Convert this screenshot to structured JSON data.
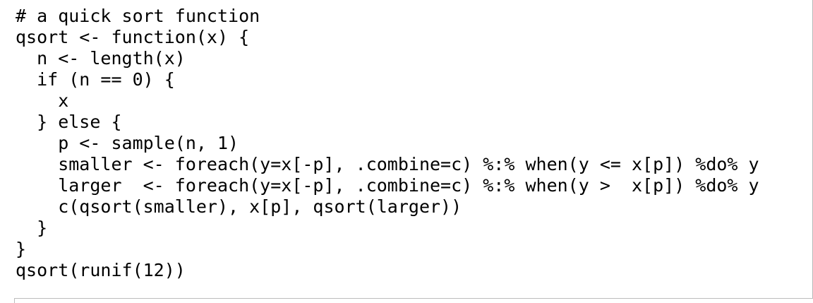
{
  "code": {
    "lines": [
      "# a quick sort function",
      "qsort <- function(x) {",
      "  n <- length(x)",
      "  if (n == 0) {",
      "    x",
      "  } else {",
      "    p <- sample(n, 1)",
      "    smaller <- foreach(y=x[-p], .combine=c) %:% when(y <= x[p]) %do% y",
      "    larger  <- foreach(y=x[-p], .combine=c) %:% when(y >  x[p]) %do% y",
      "    c(qsort(smaller), x[p], qsort(larger))",
      "  }",
      "}",
      "qsort(runif(12))"
    ]
  }
}
